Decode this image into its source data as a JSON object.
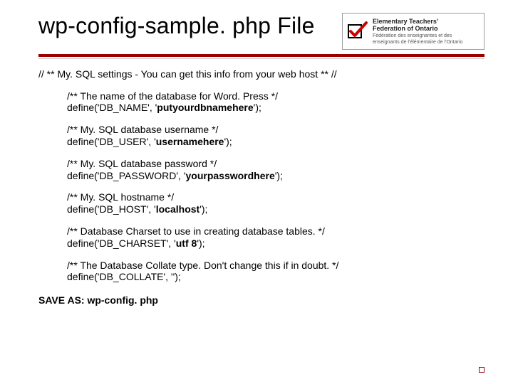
{
  "title": "wp-config-sample. php File",
  "logo": {
    "line1": "Elementary Teachers'",
    "line2": "Federation of Ontario",
    "line3": "Fédération des enseignantes et des",
    "line4": "enseignants de l'élémentaire de l'Ontario"
  },
  "lead": "// ** My. SQL settings - You can get this info from your web host ** //",
  "defines": [
    {
      "comment": "/** The name of the database for Word. Press */",
      "prefix": "define('DB_NAME', '",
      "value": "putyourdbnamehere",
      "suffix": "');"
    },
    {
      "comment": "/** My. SQL database username */",
      "prefix": "define('DB_USER', '",
      "value": "usernamehere",
      "suffix": "');"
    },
    {
      "comment": "/** My. SQL database password */",
      "prefix": "define('DB_PASSWORD', '",
      "value": "yourpasswordhere",
      "suffix": "');"
    },
    {
      "comment": "/** My. SQL hostname */",
      "prefix": "define('DB_HOST', '",
      "value": "localhost",
      "suffix": "');"
    },
    {
      "comment": "/** Database Charset to use in creating database tables. */",
      "prefix": "define('DB_CHARSET', '",
      "value": "utf 8",
      "suffix": "');"
    },
    {
      "comment": "/** The Database Collate type. Don't change this if in doubt. */",
      "prefix": "define('DB_COLLATE', '",
      "value": "",
      "suffix": "');"
    }
  ],
  "save_line": "SAVE AS: wp-config. php"
}
